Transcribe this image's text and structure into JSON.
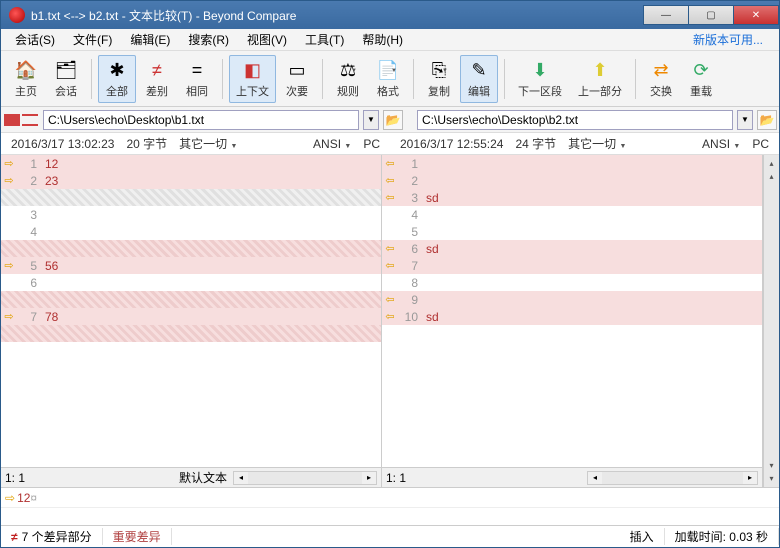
{
  "title": "b1.txt <--> b2.txt - 文本比较(T) - Beyond Compare",
  "menu": {
    "session": "会话(S)",
    "file": "文件(F)",
    "edit": "编辑(E)",
    "search": "搜索(R)",
    "view": "视图(V)",
    "tools": "工具(T)",
    "help": "帮助(H)",
    "newver": "新版本可用..."
  },
  "toolbar": {
    "home": "主页",
    "sessions": "会话",
    "all": "全部",
    "diffs": "差别",
    "same": "相同",
    "context": "上下文",
    "minor": "次要",
    "rules": "规则",
    "format": "格式",
    "copy": "复制",
    "edit": "编辑",
    "next": "下一区段",
    "prev": "上一部分",
    "swap": "交换",
    "reload": "重载"
  },
  "paths": {
    "left": "C:\\Users\\echo\\Desktop\\b1.txt",
    "right": "C:\\Users\\echo\\Desktop\\b2.txt"
  },
  "info": {
    "left": {
      "time": "2016/3/17 13:02:23",
      "size": "20 字节",
      "filter": "其它一切",
      "enc": "ANSI",
      "pc": "PC"
    },
    "right": {
      "time": "2016/3/17 12:55:24",
      "size": "24 字节",
      "filter": "其它一切",
      "enc": "ANSI",
      "pc": "PC"
    }
  },
  "left_lines": [
    {
      "n": "1",
      "t": "12",
      "cls": "diff",
      "arr": "⇨"
    },
    {
      "n": "2",
      "t": "23",
      "cls": "diff",
      "arr": "⇨"
    },
    {
      "n": "",
      "t": "",
      "cls": "hatch",
      "arr": ""
    },
    {
      "n": "3",
      "t": "",
      "cls": "",
      "arr": ""
    },
    {
      "n": "4",
      "t": "",
      "cls": "",
      "arr": ""
    },
    {
      "n": "",
      "t": "",
      "cls": "hatchpink",
      "arr": ""
    },
    {
      "n": "5",
      "t": "56",
      "cls": "diff",
      "arr": "⇨"
    },
    {
      "n": "6",
      "t": "",
      "cls": "",
      "arr": ""
    },
    {
      "n": "",
      "t": "",
      "cls": "hatchpink",
      "arr": ""
    },
    {
      "n": "7",
      "t": "78",
      "cls": "diff",
      "arr": "⇨"
    },
    {
      "n": "",
      "t": "",
      "cls": "hatchpink",
      "arr": ""
    }
  ],
  "right_lines": [
    {
      "n": "1",
      "t": "",
      "cls": "diff",
      "arr": "⇦"
    },
    {
      "n": "2",
      "t": "",
      "cls": "diff",
      "arr": "⇦"
    },
    {
      "n": "3",
      "t": "sd",
      "cls": "diff",
      "arr": "⇦"
    },
    {
      "n": "4",
      "t": "",
      "cls": "",
      "arr": ""
    },
    {
      "n": "5",
      "t": "",
      "cls": "",
      "arr": ""
    },
    {
      "n": "6",
      "t": "sd",
      "cls": "diff",
      "arr": "⇦"
    },
    {
      "n": "7",
      "t": "",
      "cls": "diff",
      "arr": "⇦"
    },
    {
      "n": "8",
      "t": "",
      "cls": "",
      "arr": ""
    },
    {
      "n": "9",
      "t": "",
      "cls": "diff",
      "arr": "⇦"
    },
    {
      "n": "10",
      "t": "sd",
      "cls": "diff",
      "arr": "⇦"
    }
  ],
  "panestat": {
    "left_pos": "1: 1",
    "left_mode": "默认文本",
    "right_pos": "1: 1"
  },
  "editstrip": {
    "arrow": "⇨",
    "text": "12",
    "cursor": "¤"
  },
  "status": {
    "neq": "≠",
    "diffs": "7 个差异部分",
    "major": "重要差异",
    "insert": "插入",
    "load": "加载时间: 0.03 秒"
  }
}
